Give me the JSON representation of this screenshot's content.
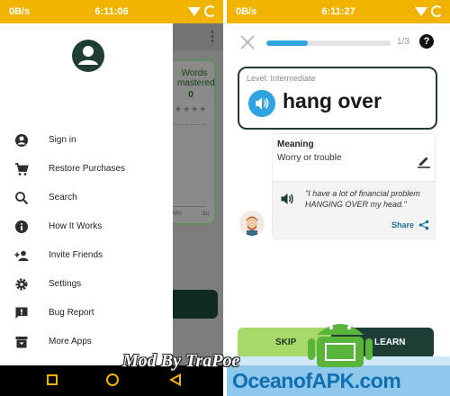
{
  "left_screen": {
    "status": {
      "speed": "0B/s",
      "time": "6:11:06"
    },
    "background_app": {
      "words_mastered_label": "Words mastered",
      "words_mastered_value": "0",
      "stars": "★★★★",
      "axis_labels": [
        "Mo",
        "Su"
      ]
    },
    "drawer": {
      "items": [
        {
          "label": "Sign in",
          "icon": "account-icon"
        },
        {
          "label": "Restore Purchases",
          "icon": "cart-icon"
        },
        {
          "label": "Search",
          "icon": "search-icon"
        },
        {
          "label": "How It Works",
          "icon": "info-icon"
        },
        {
          "label": "Invite Friends",
          "icon": "person-add-icon"
        },
        {
          "label": "Settings",
          "icon": "gear-icon"
        },
        {
          "label": "Bug Report",
          "icon": "feedback-icon"
        },
        {
          "label": "More Apps",
          "icon": "archive-icon"
        }
      ]
    }
  },
  "right_screen": {
    "status": {
      "speed": "0B/s",
      "time": "6:11:27"
    },
    "progress": {
      "counter": "1/3",
      "fraction": 0.33
    },
    "help_label": "?",
    "card": {
      "level": "Level: Intermediate",
      "word": "hang over"
    },
    "meaning": {
      "title": "Meaning",
      "text": "Worry or trouble",
      "example": "\"I have a lot of financial problem HANGING OVER my head.\"",
      "share_label": "Share"
    },
    "buttons": {
      "skip": "SKIP",
      "learn": "LEARN"
    }
  },
  "watermark": {
    "mod_text": "Mod By TraPoe",
    "site": "OceanofAPK.com"
  },
  "colors": {
    "status_bar": "#f0b400",
    "accent_blue": "#2fa3e0",
    "dark_green": "#1e3d36",
    "skip_green": "#a8d86a"
  }
}
